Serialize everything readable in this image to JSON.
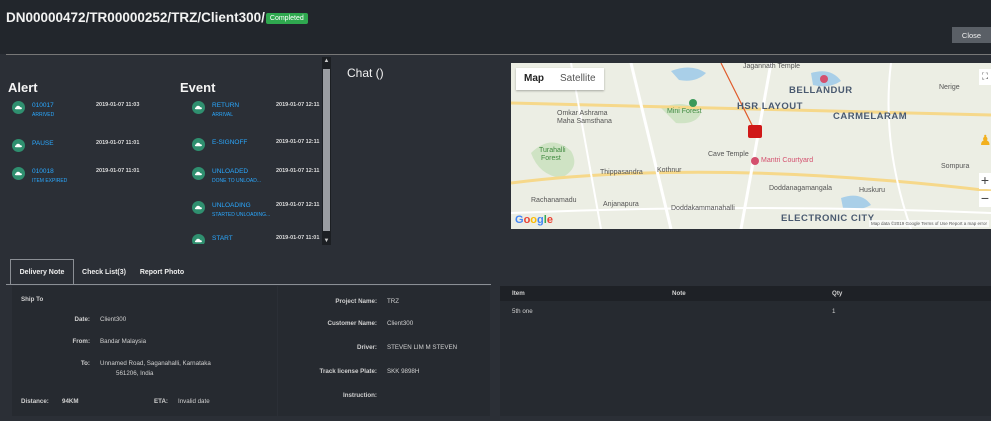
{
  "header": {
    "title": "DN00000472/TR00000252/TRZ/Client300/",
    "status_badge": "Completed",
    "close_label": "Close"
  },
  "alert": {
    "title": "Alert",
    "items": [
      {
        "code": "010017",
        "sub": "ARRIVED",
        "time": "2019-01-07 11:03"
      },
      {
        "code": "PAUSE",
        "sub": "",
        "time": "2019-01-07 11:01"
      },
      {
        "code": "010018",
        "sub": "ITEM EXPIRED",
        "time": "2019-01-07 11:01"
      }
    ]
  },
  "event": {
    "title": "Event",
    "items": [
      {
        "code": "RETURN",
        "sub": "ARRIVAL",
        "time": "2019-01-07 12:11"
      },
      {
        "code": "E-SIGNOFF",
        "sub": "",
        "time": "2019-01-07 12:11"
      },
      {
        "code": "UNLOADED",
        "sub": "DONE TO UNLOAD...",
        "time": "2019-01-07 12:11"
      },
      {
        "code": "UNLOADING",
        "sub": "STARTED UNLOADING...",
        "time": "2019-01-07 12:11"
      },
      {
        "code": "START",
        "sub": "",
        "time": "2019-01-07 11:01"
      }
    ]
  },
  "chat": {
    "title": "Chat ()"
  },
  "map": {
    "map_label": "Map",
    "satellite_label": "Satellite",
    "places": {
      "bellandur": "BELLANDUR",
      "hsr": "HSR LAYOUT",
      "carmelaram": "CARMELARAM",
      "electronic_city": "ELECTRONIC CITY",
      "mini_forest": "Mini Forest",
      "omkar": "Omkar Ashrama",
      "omkar2": "Maha Samsthana",
      "turahalli": "Turahalli",
      "turahalli2": "Forest",
      "thippasandra": "Thippasandra",
      "kothnur": "Kothnur",
      "cave_temple": "Cave Temple",
      "mantri": "Mantri Courtyard",
      "rachanamadu": "Rachanamadu",
      "anjanapura": "Anjanapura",
      "doddakammanahalli": "Doddakammanahalli",
      "doddanagamangala": "Doddanagamangala",
      "huskuru": "Huskuru",
      "sompura": "Sompura",
      "nerige": "Nerige",
      "jagannath": "Jagannath Temple"
    },
    "google": "Google",
    "footer": "Map data ©2019 Google   Terms of Use   Report a map error"
  },
  "tabs": [
    {
      "label": "Delivery Note"
    },
    {
      "label": "Check List(3)"
    },
    {
      "label": "Report Photo"
    }
  ],
  "delivery": {
    "ship_to_label": "Ship To",
    "date_label": "Date:",
    "date_value": "Client300",
    "from_label": "From:",
    "from_value": "Bandar Malaysia",
    "to_label": "To:",
    "to_value_line1": "Unnamed Road, Saganahalli, Karnataka",
    "to_value_line2": "561206, India",
    "distance_label": "Distance:",
    "distance_value": "94KM",
    "eta_label": "ETA:",
    "eta_value": "Invalid date",
    "project_label": "Project Name:",
    "project_value": "TRZ",
    "customer_label": "Customer Name:",
    "customer_value": "Client300",
    "driver_label": "Driver:",
    "driver_value": "STEVEN LIM M STEVEN",
    "plate_label": "Track license Plate:",
    "plate_value": "SKK 9898H",
    "instruction_label": "Instruction:"
  },
  "items_table": {
    "headers": [
      "Item",
      "Note",
      "Qty"
    ],
    "rows": [
      {
        "item": "5th one",
        "note": "",
        "qty": "1"
      }
    ]
  },
  "colors": {
    "background": "#2b2f36",
    "header": "#22262c",
    "accent_blue": "#2aa8ff",
    "completed_green": "#2fa84f",
    "truck_red": "#d01818"
  }
}
